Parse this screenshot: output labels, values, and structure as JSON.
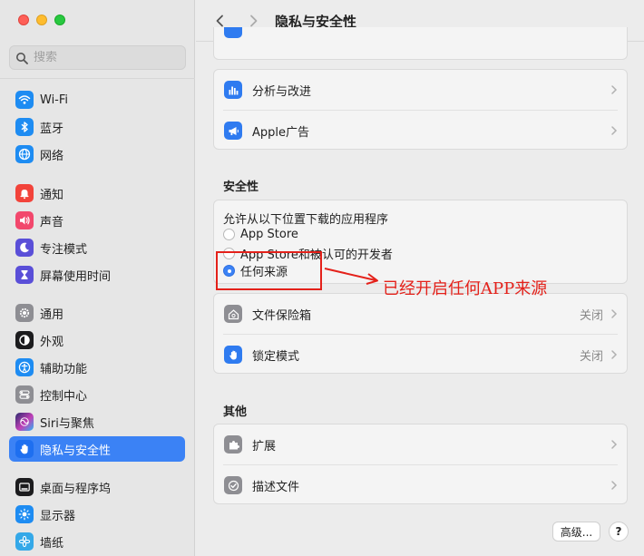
{
  "window": {
    "title": "隐私与安全性"
  },
  "search": {
    "placeholder": "搜索"
  },
  "sidebar": {
    "items": [
      {
        "label": "Wi-Fi"
      },
      {
        "label": "蓝牙"
      },
      {
        "label": "网络"
      },
      {
        "label": "通知"
      },
      {
        "label": "声音"
      },
      {
        "label": "专注模式"
      },
      {
        "label": "屏幕使用时间"
      },
      {
        "label": "通用"
      },
      {
        "label": "外观"
      },
      {
        "label": "辅助功能"
      },
      {
        "label": "控制中心"
      },
      {
        "label": "Siri与聚焦"
      },
      {
        "label": "隐私与安全性"
      },
      {
        "label": "桌面与程序坞"
      },
      {
        "label": "显示器"
      },
      {
        "label": "墙纸"
      }
    ]
  },
  "privacy_rows": [
    {
      "label": "分析与改进"
    },
    {
      "label": "Apple广告"
    }
  ],
  "security": {
    "title": "安全性",
    "allow_label": "允许从以下位置下载的应用程序",
    "options": [
      {
        "label": "App Store",
        "checked": false
      },
      {
        "label": "App Store和被认可的开发者",
        "checked": false
      },
      {
        "label": "任何来源",
        "checked": true
      }
    ],
    "rows": [
      {
        "label": "文件保险箱",
        "value": "关闭"
      },
      {
        "label": "锁定模式",
        "value": "关闭"
      }
    ]
  },
  "other": {
    "title": "其他",
    "rows": [
      {
        "label": "扩展"
      },
      {
        "label": "描述文件"
      }
    ]
  },
  "footer": {
    "advanced_label": "高级...",
    "help_label": "?"
  },
  "annotation": {
    "text": "已经开启任何APP来源"
  },
  "colors": {
    "accent": "#3b82f5",
    "annotation": "#e4211a"
  }
}
